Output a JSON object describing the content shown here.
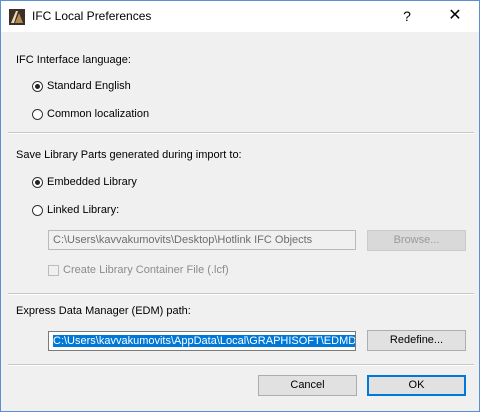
{
  "window": {
    "title": "IFC Local Preferences",
    "help_label": "?",
    "close_label": "✕"
  },
  "language": {
    "heading": "IFC Interface language:",
    "options": [
      {
        "label": "Standard English",
        "selected": true
      },
      {
        "label": "Common localization",
        "selected": false
      }
    ]
  },
  "library": {
    "heading": "Save Library Parts generated during import to:",
    "options": [
      {
        "label": "Embedded Library",
        "selected": true
      },
      {
        "label": "Linked Library:",
        "selected": false
      }
    ],
    "path_value": "C:\\Users\\kavvakumovits\\Desktop\\Hotlink IFC Objects",
    "browse_label": "Browse...",
    "container_checkbox_label": "Create Library Container File (.lcf)",
    "container_checked": false
  },
  "edm": {
    "heading": "Express Data Manager (EDM) path:",
    "path_value": "C:\\Users\\kavvakumovits\\AppData\\Local\\GRAPHISOFT\\EDMD",
    "redefine_label": "Redefine..."
  },
  "footer": {
    "cancel_label": "Cancel",
    "ok_label": "OK"
  },
  "colors": {
    "accent": "#0078d7",
    "window_border": "#5a8fd8",
    "dialog_bg": "#f0f0f0"
  }
}
